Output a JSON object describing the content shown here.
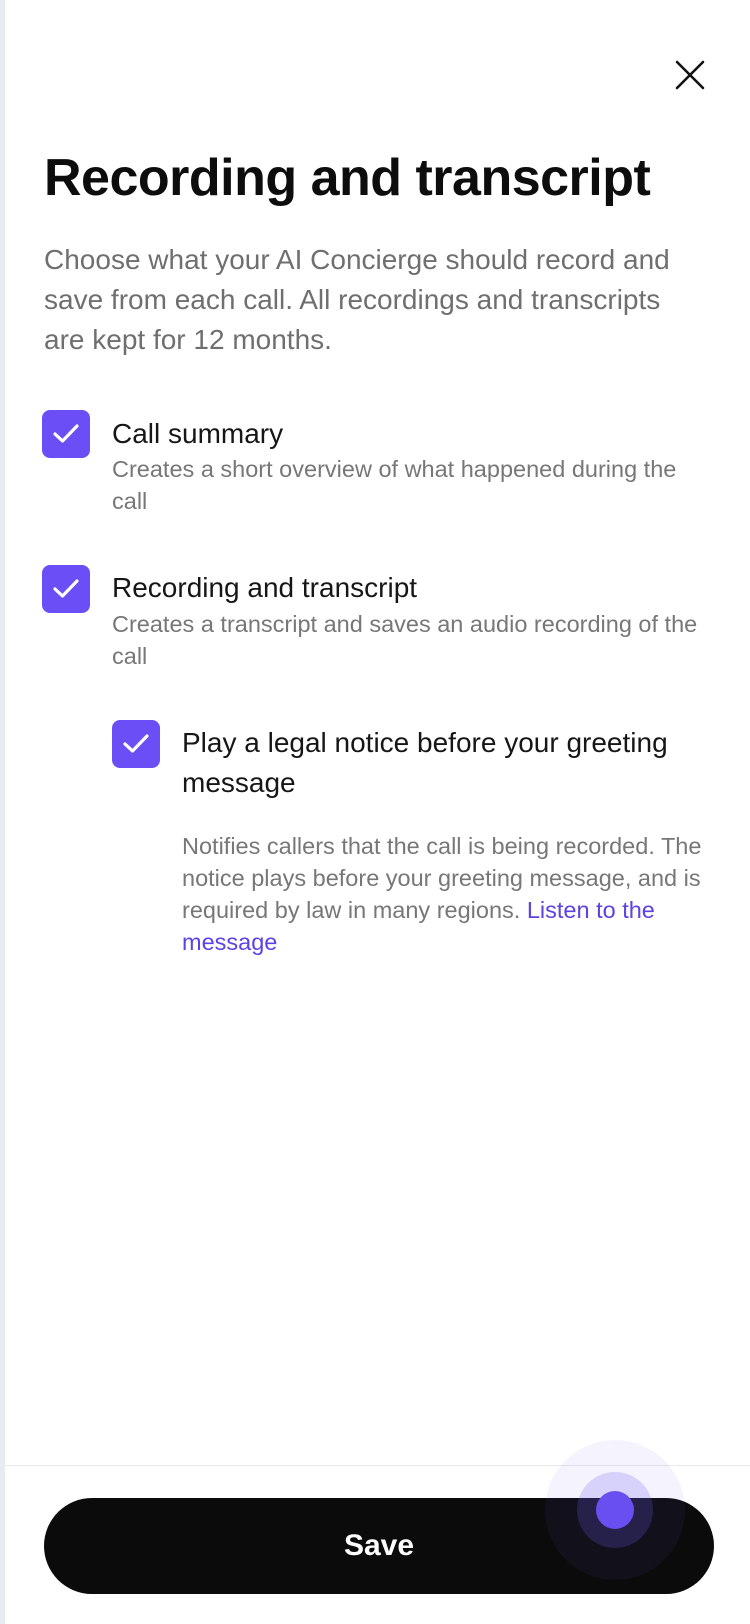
{
  "modal": {
    "title": "Recording and transcript",
    "description": "Choose what your AI Concierge should record and save from each call. All recordings and transcripts are kept for 12 months.",
    "close_icon": "close-icon"
  },
  "options": [
    {
      "label": "Call summary",
      "description": "Creates a short overview of what happened during the call",
      "checked": true
    },
    {
      "label": "Recording and transcript",
      "description": "Creates a transcript and saves an audio recording of the call",
      "checked": true
    },
    {
      "label": "Play a legal notice before your greeting message",
      "description": "Notifies callers that the call is being recorded. The notice plays before your greeting message, and is required by law in many regions.",
      "link_text": "Listen to the message",
      "checked": true
    }
  ],
  "footer": {
    "save_label": "Save"
  },
  "colors": {
    "accent": "#6b4ef5",
    "link": "#5b43e6",
    "button": "#0b0b0b"
  }
}
